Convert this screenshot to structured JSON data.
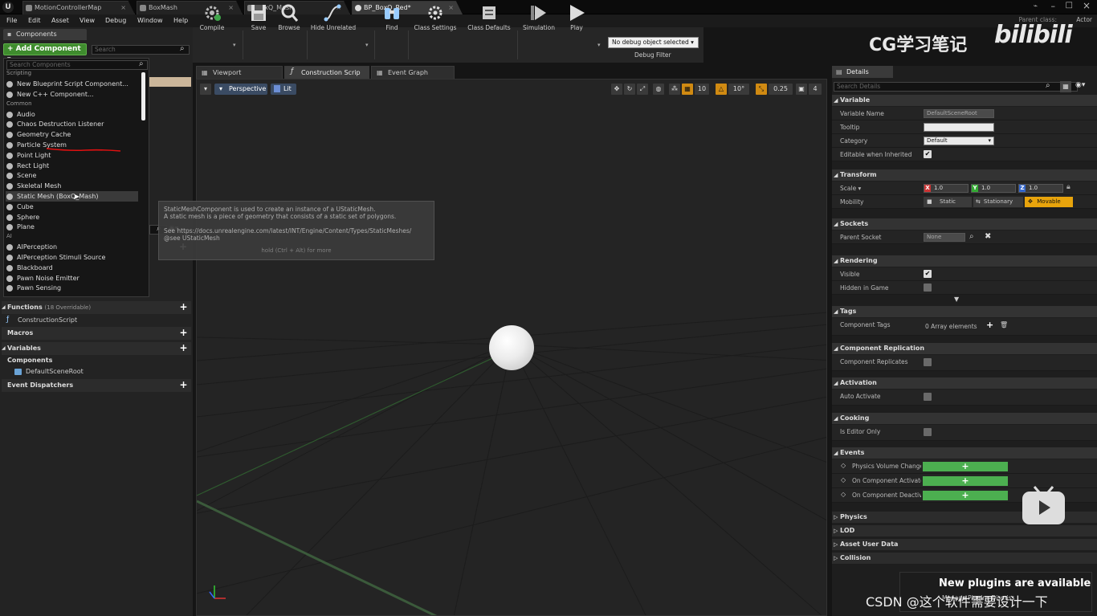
{
  "titlebar": {
    "tabs": [
      {
        "label": "MotionControllerMap"
      },
      {
        "label": "BoxMash"
      },
      {
        "label": "BoxQ_Mash"
      },
      {
        "label": "BP_BoxQ_Red*"
      }
    ]
  },
  "menubar": {
    "items": [
      "File",
      "Edit",
      "Asset",
      "View",
      "Debug",
      "Window",
      "Help"
    ],
    "parent_class_label": "Parent class:",
    "parent_class_value": "Actor"
  },
  "components_panel": {
    "tab_label": "Components",
    "add_component_label": "+ Add Component ▾",
    "search_placeholder": "Search"
  },
  "add_component_menu": {
    "search_placeholder": "Search Components",
    "sections": [
      {
        "header": "Scripting",
        "items": [
          "New Blueprint Script Component...",
          "New C++ Component..."
        ]
      },
      {
        "header": "Common",
        "items": [
          "Audio",
          "Chaos Destruction Listener",
          "Geometry Cache",
          "Particle System",
          "Point Light",
          "Rect Light",
          "Scene",
          "Skeletal Mesh",
          "Static Mesh  (BoxQ_Mash)",
          "Cube",
          "Sphere",
          "Plane"
        ]
      },
      {
        "header": "AI",
        "items": [
          "AIPerception",
          "AIPerception Stimuli Source",
          "Blackboard",
          "Pawn Noise Emitter",
          "Pawn Sensing"
        ]
      }
    ],
    "highlighted_item": "Static Mesh  (BoxQ_Mash)"
  },
  "my_blueprint": {
    "functions_label": "Functions",
    "functions_count": "(18 Overridable)",
    "functions_items": [
      "ConstructionScript"
    ],
    "macros_label": "Macros",
    "variables_label": "Variables",
    "components_label": "Components",
    "components_items": [
      "DefaultSceneRoot"
    ],
    "event_dispatchers_label": "Event Dispatchers"
  },
  "toolbar": {
    "buttons": [
      {
        "label": "Compile",
        "icon": "compile-gear-icon"
      },
      {
        "label": "Save",
        "icon": "save-disk-icon"
      },
      {
        "label": "Browse",
        "icon": "browse-magnifier-icon"
      },
      {
        "label": "Hide Unrelated",
        "icon": "hide-unrelated-icon"
      },
      {
        "label": "Find",
        "icon": "find-binoculars-icon"
      },
      {
        "label": "Class Settings",
        "icon": "class-settings-icon"
      },
      {
        "label": "Class Defaults",
        "icon": "class-defaults-icon"
      },
      {
        "label": "Simulation",
        "icon": "simulation-icon"
      },
      {
        "label": "Play",
        "icon": "play-icon"
      }
    ],
    "debug_select_value": "No debug object selected ▾",
    "debug_filter_label": "Debug Filter"
  },
  "watermark": {
    "text": "CG学习笔记",
    "brand": "bilibili"
  },
  "editor_tabs": [
    {
      "label": "Viewport"
    },
    {
      "label": "Construction Scrip"
    },
    {
      "label": "Event Graph"
    }
  ],
  "viewport": {
    "perspective_label": "Perspective",
    "lit_label": "Lit",
    "grid_snap": "10",
    "rotation_snap": "10°",
    "scale_snap": "0.25",
    "camera_speed": "4"
  },
  "tooltip": {
    "line1": "StaticMeshComponent is used to create an instance of a UStaticMesh.",
    "line2": "A static mesh is a piece of geometry that consists of a static set of polygons.",
    "line3": "See https://docs.unrealengine.com/latest/INT/Engine/Content/Types/StaticMeshes/",
    "line4": "@see UStaticMesh",
    "hint": "hold (Ctrl + Alt) for more"
  },
  "details": {
    "tab_label": "Details",
    "search_placeholder": "Search Details",
    "variable": {
      "header": "Variable",
      "name_label": "Variable Name",
      "name_value": "DefaultSceneRoot",
      "tooltip_label": "Tooltip",
      "tooltip_value": "",
      "category_label": "Category",
      "category_value": "Default",
      "editable_label": "Editable when Inherited",
      "editable_checked": "✔"
    },
    "transform": {
      "header": "Transform",
      "scale_label": "Scale ▾",
      "scale_x": "1.0",
      "scale_y": "1.0",
      "scale_z": "1.0",
      "mobility_label": "Mobility",
      "mobility_options": [
        "Static",
        "Stationary",
        "Movable"
      ],
      "mobility_selected": "Movable"
    },
    "sockets": {
      "header": "Sockets",
      "parent_socket_label": "Parent Socket",
      "parent_socket_value": "None"
    },
    "rendering": {
      "header": "Rendering",
      "visible_label": "Visible",
      "visible_checked": "✔",
      "hidden_label": "Hidden in Game"
    },
    "tags": {
      "header": "Tags",
      "component_tags_label": "Component Tags",
      "component_tags_value": "0 Array elements"
    },
    "component_replication": {
      "header": "Component Replication",
      "replicates_label": "Component Replicates"
    },
    "activation": {
      "header": "Activation",
      "auto_activate_label": "Auto Activate"
    },
    "cooking": {
      "header": "Cooking",
      "editor_only_label": "Is Editor Only"
    },
    "events": {
      "header": "Events",
      "items": [
        "Physics Volume Change",
        "On Component Activate",
        "On Component Deactiv"
      ]
    },
    "collapsed_sections": [
      "Physics",
      "LOD",
      "Asset User Data",
      "Collision"
    ]
  },
  "notification": {
    "title": "New plugins are available",
    "subtext": "Manage Plugins  Dismiss"
  },
  "overlay": {
    "csdn": "CSDN @这个软件需要设计一下"
  },
  "colors": {
    "accent_green": "#4caf50",
    "movable_orange": "#e8a40c",
    "add_component_green": "#3f8c2e",
    "perspective_blue": "#3a4b63"
  }
}
